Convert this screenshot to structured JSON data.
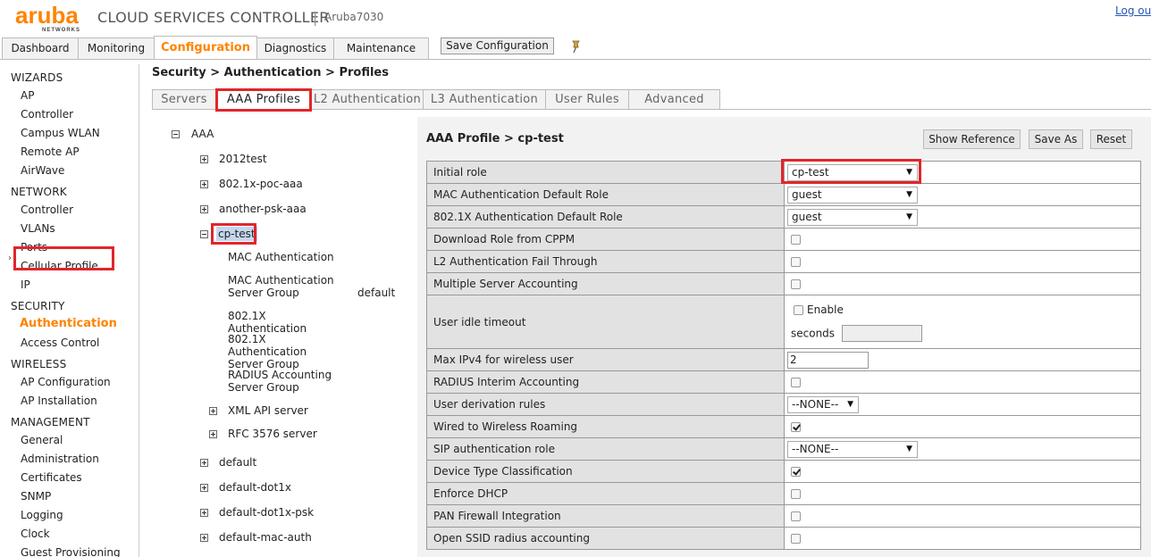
{
  "header": {
    "logo_word": "aruba",
    "logo_sub": "NETWORKS",
    "product_title": "CLOUD SERVICES CONTROLLER",
    "divider": "|",
    "hostname": "Aruba7030",
    "logout": "Log ou"
  },
  "main_tabs": [
    "Dashboard",
    "Monitoring",
    "Configuration",
    "Diagnostics",
    "Maintenance"
  ],
  "main_tabs_active": "Configuration",
  "save_config_label": "Save Configuration",
  "sidebar": {
    "wizards": {
      "heading": "WIZARDS",
      "items": [
        "AP",
        "Controller",
        "Campus WLAN",
        "Remote AP",
        "AirWave"
      ]
    },
    "network": {
      "heading": "NETWORK",
      "items": [
        "Controller",
        "VLANs",
        "Ports",
        "Cellular Profile",
        "IP"
      ]
    },
    "security": {
      "heading": "SECURITY",
      "items": [
        "Authentication",
        "Access Control"
      ]
    },
    "wireless": {
      "heading": "WIRELESS",
      "items": [
        "AP Configuration",
        "AP Installation"
      ]
    },
    "management": {
      "heading": "MANAGEMENT",
      "items": [
        "General",
        "Administration",
        "Certificates",
        "SNMP",
        "Logging",
        "Clock",
        "Guest Provisioning"
      ]
    },
    "active": "Authentication"
  },
  "breadcrumb": "Security > Authentication > Profiles",
  "sub_tabs": [
    "Servers",
    "AAA Profiles",
    "L2 Authentication",
    "L3 Authentication",
    "User Rules",
    "Advanced"
  ],
  "sub_tabs_active": "AAA Profiles",
  "tree": {
    "root": "AAA",
    "profiles_before": [
      "2012test",
      "802.1x-poc-aaa",
      "another-psk-aaa"
    ],
    "selected": "cp-test",
    "children": [
      {
        "label": "MAC Authentication",
        "value": ""
      },
      {
        "label": "MAC Authentication Server Group",
        "value": "default"
      },
      {
        "label": "802.1X Authentication",
        "value": ""
      },
      {
        "label": "802.1X Authentication Server Group",
        "value": ""
      },
      {
        "label": "RADIUS Accounting Server Group",
        "value": ""
      }
    ],
    "expandable_children": [
      "XML API server",
      "RFC 3576 server"
    ],
    "profiles_after": [
      "default",
      "default-dot1x",
      "default-dot1x-psk",
      "default-mac-auth"
    ]
  },
  "panel": {
    "title": "AAA Profile > cp-test",
    "buttons": [
      "Show Reference",
      "Save As",
      "Reset"
    ],
    "rows": [
      {
        "label": "Initial role",
        "type": "select",
        "value": "cp-test"
      },
      {
        "label": "MAC Authentication Default Role",
        "type": "select",
        "value": "guest"
      },
      {
        "label": "802.1X Authentication Default Role",
        "type": "select",
        "value": "guest"
      },
      {
        "label": "Download Role from CPPM",
        "type": "checkbox",
        "checked": false
      },
      {
        "label": "L2 Authentication Fail Through",
        "type": "checkbox",
        "checked": false
      },
      {
        "label": "Multiple Server Accounting",
        "type": "checkbox",
        "checked": false
      },
      {
        "label": "User idle timeout",
        "type": "idle",
        "enable_label": "Enable",
        "seconds_label": "seconds",
        "enabled": false,
        "seconds_value": ""
      },
      {
        "label": "Max IPv4 for wireless user",
        "type": "text",
        "value": "2"
      },
      {
        "label": "RADIUS Interim Accounting",
        "type": "checkbox",
        "checked": false
      },
      {
        "label": "User derivation rules",
        "type": "select-small",
        "value": "--NONE--"
      },
      {
        "label": "Wired to Wireless Roaming",
        "type": "checkbox",
        "checked": true
      },
      {
        "label": "SIP authentication role",
        "type": "select",
        "value": "--NONE--"
      },
      {
        "label": "Device Type Classification",
        "type": "checkbox",
        "checked": true
      },
      {
        "label": "Enforce DHCP",
        "type": "checkbox",
        "checked": false
      },
      {
        "label": "PAN Firewall Integration",
        "type": "checkbox",
        "checked": false
      },
      {
        "label": "Open SSID radius accounting",
        "type": "checkbox",
        "checked": false
      }
    ]
  },
  "icons": {
    "dropdown_arrow": "▼",
    "collapsed_arrow": "›",
    "pin": "pin-icon"
  },
  "colors": {
    "brand_orange": "#ff8300",
    "highlight_red": "#e0262b",
    "selection_blue": "#c4d7ee",
    "label_cell_gray": "#e2e2e2"
  }
}
